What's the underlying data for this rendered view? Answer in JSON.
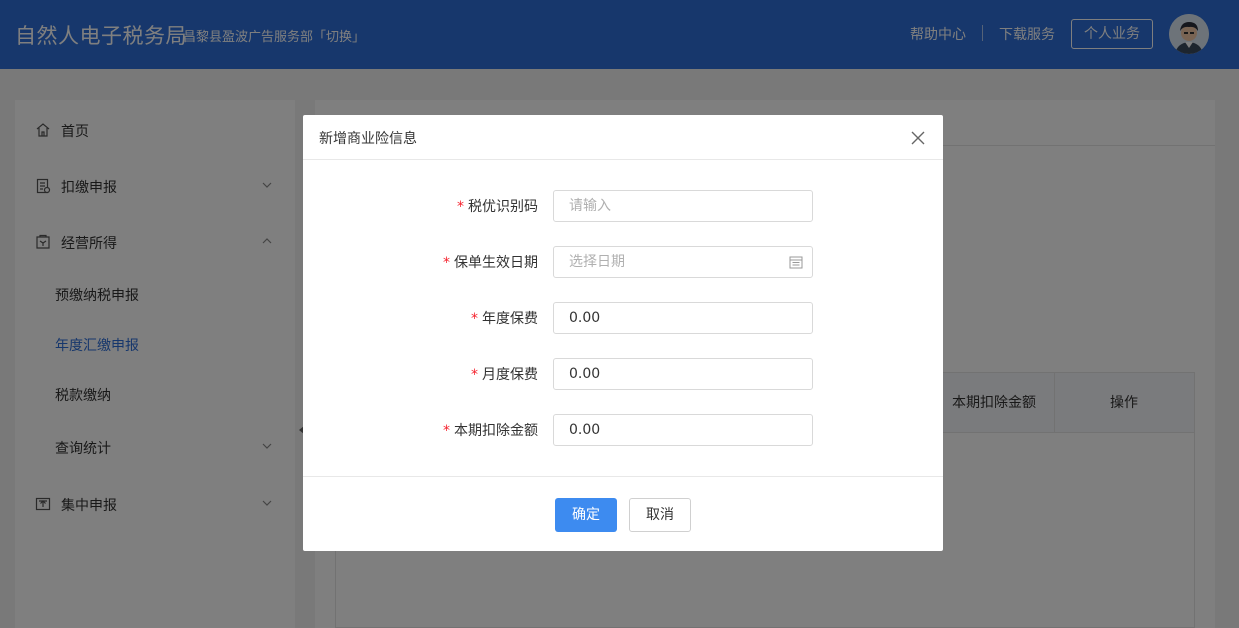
{
  "header": {
    "brand": "自然人电子税务局",
    "org": "昌黎县盈波广告服务部「切换」",
    "help_link": "帮助中心",
    "download_link": "下载服务",
    "personal_button": "个人业务",
    "avatar_icon": "user-avatar-icon"
  },
  "sidebar": {
    "items": [
      {
        "label": "首页",
        "icon": "home-icon"
      },
      {
        "label": "扣缴申报",
        "icon": "document-icon",
        "expanded": false
      },
      {
        "label": "经营所得",
        "icon": "business-icon",
        "expanded": true
      },
      {
        "label": "集中申报",
        "icon": "upload-icon",
        "expanded": false
      }
    ],
    "sub_items": [
      {
        "label": "预缴纳税申报",
        "active": false
      },
      {
        "label": "年度汇缴申报",
        "active": true
      },
      {
        "label": "税款缴纳",
        "active": false
      },
      {
        "label": "查询统计",
        "active": false,
        "expandable": true
      }
    ]
  },
  "main": {
    "table": {
      "columns": [
        "本期扣除金额",
        "操作"
      ]
    }
  },
  "modal": {
    "title": "新增商业险信息",
    "close_icon": "close-icon",
    "fields": [
      {
        "label": "税优识别码",
        "required": true,
        "value": "",
        "placeholder": "请输入"
      },
      {
        "label": "保单生效日期",
        "required": true,
        "value": "",
        "placeholder": "选择日期",
        "icon": "calendar-icon"
      },
      {
        "label": "年度保费",
        "required": true,
        "value": "0.00",
        "placeholder": ""
      },
      {
        "label": "月度保费",
        "required": true,
        "value": "0.00",
        "placeholder": ""
      },
      {
        "label": "本期扣除金额",
        "required": true,
        "value": "0.00",
        "placeholder": ""
      }
    ],
    "required_mark": "*",
    "ok_button": "确定",
    "cancel_button": "取消"
  },
  "colors": {
    "header_bg": "#2f6fd8",
    "primary_button": "#3d8bf0",
    "active_nav": "#2f6fd8",
    "required": "#f5222d"
  }
}
